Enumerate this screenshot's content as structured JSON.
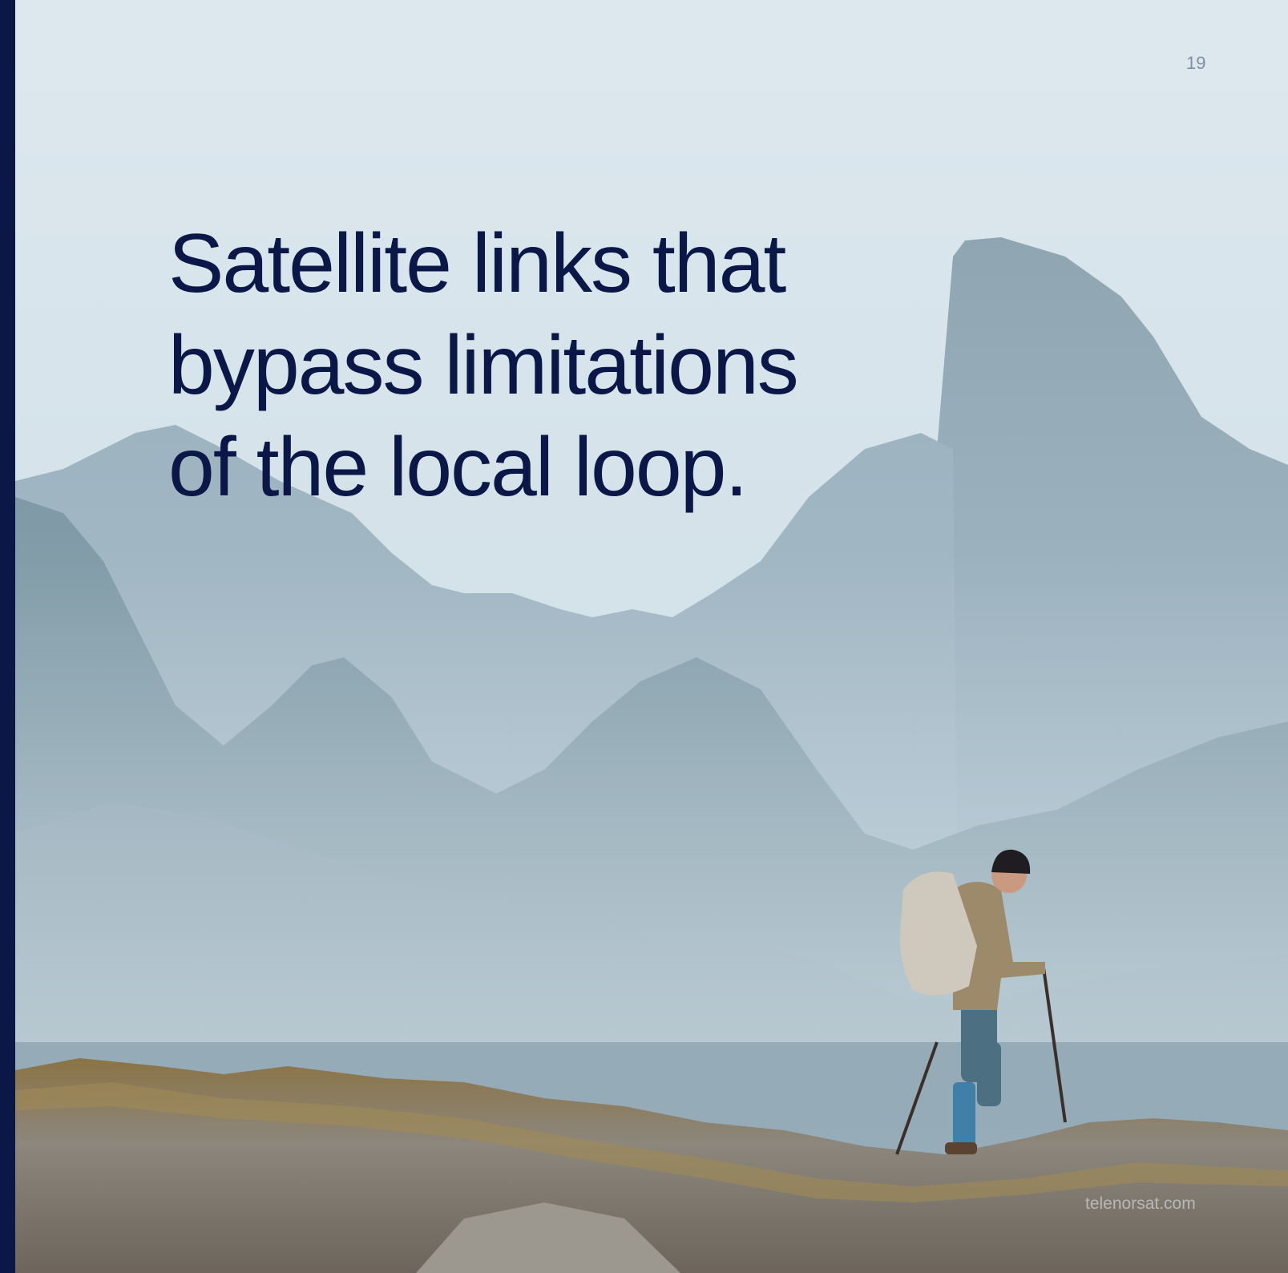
{
  "page": {
    "number": "19",
    "headline_lines": [
      "Satellite links that",
      "bypass limitations",
      "of the local loop."
    ],
    "footer_url": "telenorsat.com"
  },
  "photo": {
    "subject": "hiker-with-backpack-and-trekking-poles",
    "scene": "misty-mountains-rocky-ridge"
  },
  "colors": {
    "spine": "#0a1747",
    "headline": "#0a1747",
    "sky_top": "#dbe6ec",
    "sky_bottom": "#c9d8e1",
    "mountain_far": "#a9bfcc",
    "mountain_mid": "#8fa9b8",
    "mountain_near": "#7f9aa8",
    "ridge_moss": "#8a6a35",
    "ridge_rock": "#8f8a82"
  }
}
